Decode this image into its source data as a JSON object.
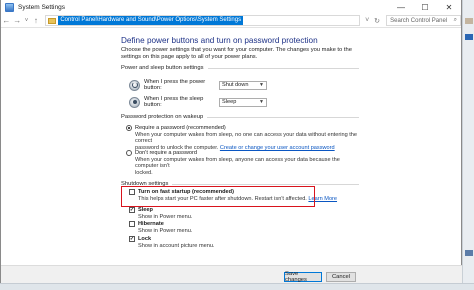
{
  "window": {
    "title": "System Settings"
  },
  "titlebar": {
    "minimize": "—",
    "maximize": "☐",
    "close": "✕"
  },
  "address": {
    "path": "Control Panel\\Hardware and Sound\\Power Options\\System Settings",
    "search_placeholder": "Search Control Panel",
    "nav": {
      "back": "←",
      "forward": "→",
      "recent": "˅",
      "up": "↑",
      "dropdown": "˅",
      "refresh": "↻"
    }
  },
  "page": {
    "title": "Define power buttons and turn on password protection",
    "description": "Choose the power settings that you want for your computer. The changes you make to the settings on this page apply to all of your power plans."
  },
  "power_section": {
    "label": "Power and sleep button settings",
    "power_button": {
      "label": "When I press the power button:",
      "value": "Shut down"
    },
    "sleep_button": {
      "label": "When I press the sleep button:",
      "value": "Sleep"
    }
  },
  "password_section": {
    "label": "Password protection on wakeup",
    "require": {
      "label": "Require a password (recommended)",
      "desc1": "When your computer wakes from sleep, no one can access your data without entering the correct",
      "desc2": "password to unlock the computer.",
      "link": "Create or change your user account password"
    },
    "dont_require": {
      "label": "Don't require a password",
      "desc1": "When your computer wakes from sleep, anyone can access your data because the computer isn't",
      "desc2": "locked."
    }
  },
  "shutdown_section": {
    "label": "Shutdown settings",
    "fast_startup": {
      "label": "Turn on fast startup (recommended)",
      "desc": "This helps start your PC faster after shutdown. Restart isn't affected.",
      "link": "Learn More",
      "checked": false
    },
    "sleep": {
      "label": "Sleep",
      "desc": "Show in Power menu.",
      "checked": true
    },
    "hibernate": {
      "label": "Hibernate",
      "desc": "Show in Power menu.",
      "checked": false
    },
    "lock": {
      "label": "Lock",
      "desc": "Show in account picture menu.",
      "checked": true
    }
  },
  "footer": {
    "save": "Save changes",
    "cancel": "Cancel"
  },
  "colors": {
    "title_blue": "#1e3287",
    "link": "#0a56c2",
    "highlight": "#d9131d",
    "selection": "#0078d7"
  }
}
